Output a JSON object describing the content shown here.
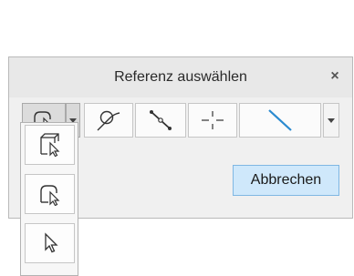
{
  "dialog": {
    "title": "Referenz auswählen",
    "close_label": "×",
    "cancel_label": "Abbrechen"
  },
  "toolbar": {
    "tools": [
      {
        "icon": "surface-select-icon"
      },
      {
        "icon": "curve-select-icon"
      },
      {
        "icon": "edge-select-icon"
      },
      {
        "icon": "point-select-icon"
      },
      {
        "icon": "line-select-icon"
      }
    ]
  },
  "dropdown_menu": {
    "items": [
      {
        "icon": "body-select-icon"
      },
      {
        "icon": "surface-select-icon"
      },
      {
        "icon": "arrow-cursor-icon"
      }
    ]
  },
  "colors": {
    "accent_button_bg": "#cfe8fb",
    "accent_button_border": "#7fb7e3",
    "line_icon": "#2a8ad0"
  }
}
